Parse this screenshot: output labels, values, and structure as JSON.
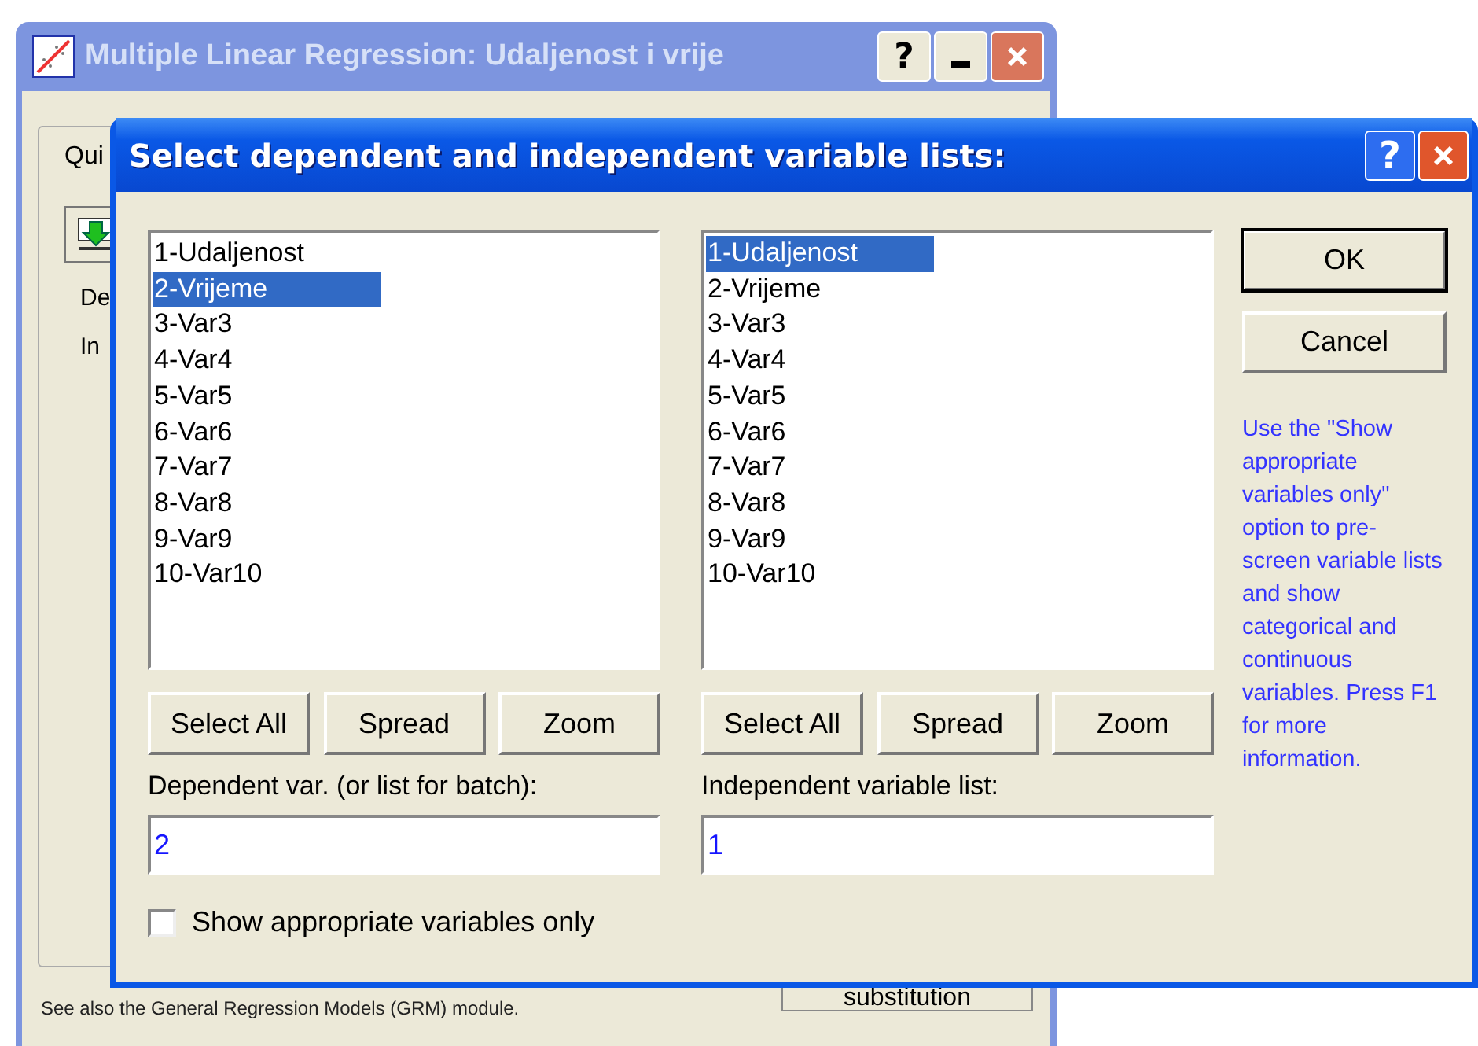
{
  "background_window": {
    "title": "Multiple Linear Regression: Udaljenost i vrije",
    "help_button": "?",
    "tab": "Qui",
    "labels": [
      "De",
      "In"
    ],
    "button": "substitution",
    "footer": "See also the General Regression Models (GRM) module."
  },
  "dialog": {
    "title": "Select dependent and independent variable lists:",
    "help_button": "?",
    "lists": [
      {
        "items": [
          {
            "label": "1-Udaljenost",
            "selected": false
          },
          {
            "label": "2-Vrijeme",
            "selected": true
          },
          {
            "label": "3-Var3",
            "selected": false
          },
          {
            "label": "4-Var4",
            "selected": false
          },
          {
            "label": "5-Var5",
            "selected": false
          },
          {
            "label": "6-Var6",
            "selected": false
          },
          {
            "label": "7-Var7",
            "selected": false
          },
          {
            "label": "8-Var8",
            "selected": false
          },
          {
            "label": "9-Var9",
            "selected": false
          },
          {
            "label": "10-Var10",
            "selected": false
          }
        ],
        "buttons": [
          "Select All",
          "Spread",
          "Zoom"
        ],
        "field_label": "Dependent var. (or list for batch):",
        "field_value": "2"
      },
      {
        "items": [
          {
            "label": "1-Udaljenost",
            "selected": true
          },
          {
            "label": "2-Vrijeme",
            "selected": false
          },
          {
            "label": "3-Var3",
            "selected": false
          },
          {
            "label": "4-Var4",
            "selected": false
          },
          {
            "label": "5-Var5",
            "selected": false
          },
          {
            "label": "6-Var6",
            "selected": false
          },
          {
            "label": "7-Var7",
            "selected": false
          },
          {
            "label": "8-Var8",
            "selected": false
          },
          {
            "label": "9-Var9",
            "selected": false
          },
          {
            "label": "10-Var10",
            "selected": false
          }
        ],
        "buttons": [
          "Select All",
          "Spread",
          "Zoom"
        ],
        "field_label": "Independent variable list:",
        "field_value": "1"
      }
    ],
    "ok": "OK",
    "cancel": "Cancel",
    "hint": "Use the \"Show appropriate variables only\" option to pre-screen variable lists and show categorical and continuous variables. Press F1 for more information.",
    "checkbox": {
      "label": "Show appropriate variables only",
      "checked": false
    }
  }
}
